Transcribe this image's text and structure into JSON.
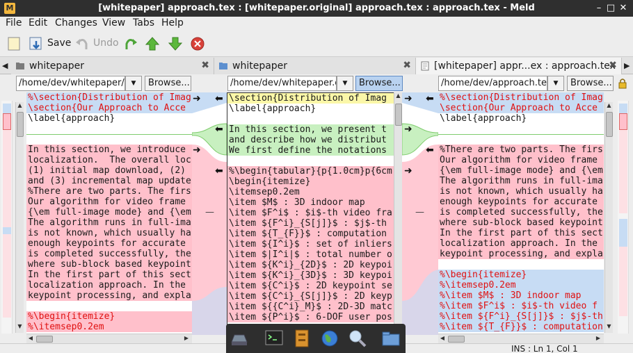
{
  "window": {
    "title": "[whitepaper] approach.tex : [whitepaper.original] approach.tex : approach.tex - Meld",
    "minimize_glyph": "–",
    "maximize_glyph": "□",
    "close_glyph": "✕"
  },
  "menu": [
    "File",
    "Edit",
    "Changes",
    "View",
    "Tabs",
    "Help"
  ],
  "toolbar": {
    "save_label": "Save",
    "undo_label": "Undo"
  },
  "tabs": [
    {
      "label": "whitepaper",
      "icon": "folder-icon"
    },
    {
      "label": "whitepaper",
      "icon": "folder-icon"
    },
    {
      "label": "[whitepaper] appr...ex : approach.tex",
      "icon": "document-icon"
    }
  ],
  "paths": [
    {
      "value": "/home/dev/whitepaper/a",
      "browse": "Browse..."
    },
    {
      "value": "/home/dev/whitepaper.o",
      "browse": "Browse..."
    },
    {
      "value": "/home/dev/approach.te",
      "browse": "Browse..."
    }
  ],
  "left_pane": {
    "lines": [
      "%\\section{Distribution of Imag",
      "\\section{Our Approach to Acce",
      "\\label{approach}",
      "",
      "",
      "In this section, we introduce",
      "localization.  The overall loc",
      "(1) initial map download, (2)",
      "and (3) incremental map update",
      "%There are two parts. The firs",
      "Our algorithm for video frame",
      "{\\em full-image mode} and {\\em",
      "The algorithm runs in full-ima",
      "is not known, which usually ha",
      "enough keypoints for accurate",
      "is completed successfully, the",
      "where sub-block based keypoint",
      "In the first part of this sect",
      "localization approach. In the",
      "keypoint processing, and expla",
      "",
      "%\\begin{itemize}",
      "%\\itemsep0.2em"
    ]
  },
  "middle_pane": {
    "lines": [
      "\\section{Distribution of Imag",
      "\\label{approach}",
      "",
      "In this section, we present t",
      "and describe how we distribut",
      "We first define the notations",
      "",
      "%\\begin{tabular}{p{1.0cm}p{6cm",
      "\\begin{itemize}",
      "\\itemsep0.2em",
      "\\item $M$ : 3D indoor map",
      "\\item $F^i$ : $i$-th video fra",
      "\\item ${F^i}_{S[j]}$ : $j$-th",
      "\\item ${T_{F}}$ : computation",
      "\\item ${I^i}$ : set of inliers",
      "\\item $|I^i|$ : total number o",
      "\\item ${K^i}_{2D}$ : 2D keypoi",
      "\\item ${K^i}_{3D}$ : 3D keypoi",
      "\\item ${C^i}$ : 2D keypoint se",
      "\\item ${C^i}_{S[j]}$ : 2D keyp",
      "\\item ${{C^i}_M}$ : 2D-3D matc",
      "\\item ${P^i}$ : 6-DOF user pos"
    ]
  },
  "right_pane": {
    "lines": [
      "%\\section{Distribution of Imag",
      "\\section{Our Approach to Acce",
      "\\label{approach}",
      "",
      "",
      "%There are two parts. The firs",
      "Our algorithm for video frame",
      "{\\em full-image mode} and {\\em",
      "The algorithm runs in full-ima",
      "is not known, which usually ha",
      "enough keypoints for accurate",
      "is completed successfully, the",
      "where sub-block based keypoint",
      "In the first part of this sect",
      "localization approach. In the",
      "keypoint processing, and expla",
      "",
      "%\\begin{itemize}",
      "%\\itemsep0.2em",
      "%\\item $M$ : 3D indoor map",
      "%\\item $F^i$ : $i$-th video f",
      "%\\item ${F^i}_{S[j]}$ : $j$-th",
      "%\\item ${T_{F}}$ : computation"
    ]
  },
  "status": {
    "text": "INS : Ln 1, Col 1"
  },
  "colors": {
    "changed": "#ffc0cb",
    "inserted": "#c8f0c0",
    "deleted": "#c7dcf4",
    "removed_text": "#e01010"
  }
}
